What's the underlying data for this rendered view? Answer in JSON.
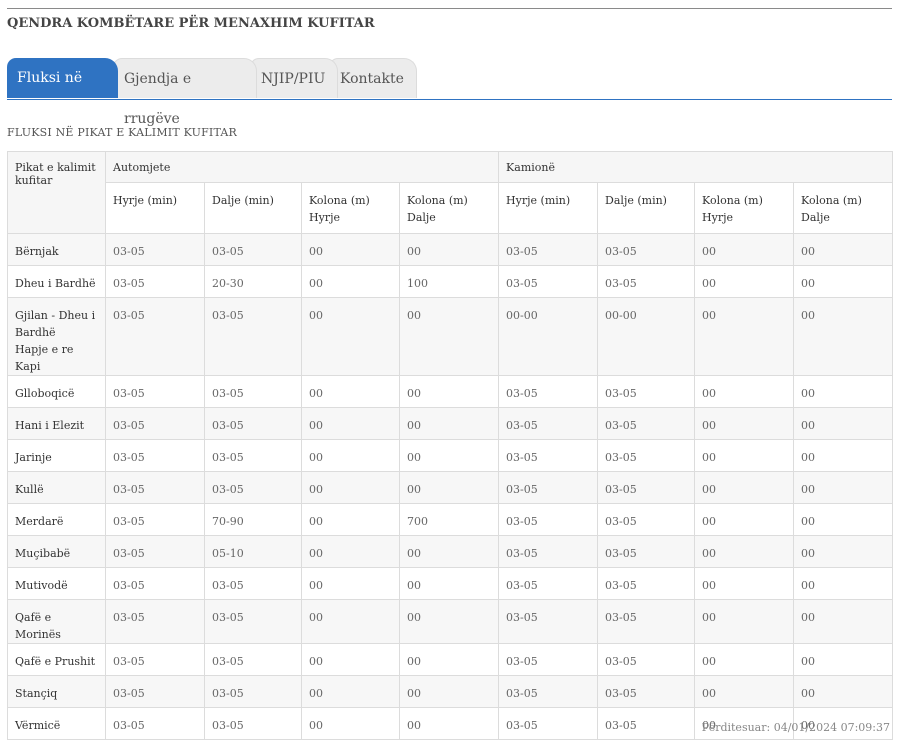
{
  "header": {
    "title": "QENDRA KOMBËTARE PËR MENAXHIM KUFITAR"
  },
  "tabs": [
    {
      "label": "Fluksi në kufi"
    },
    {
      "label": "Gjendja e rrugëve"
    },
    {
      "label": "NJIP/PIU"
    },
    {
      "label": "Kontakte"
    }
  ],
  "section_title": "FLUKSI NË PIKAT E KALIMIT KUFITAR",
  "table": {
    "corner_label": "Pikat e kalimit kufitar",
    "group_cars": "Automjete",
    "group_trucks": "Kamionë",
    "cols": [
      "Hyrje (min)",
      "Dalje (min)",
      "Kolona (m) Hyrje",
      "Kolona (m) Dalje"
    ],
    "rows": [
      {
        "name": "Bërnjak",
        "v": [
          "03-05",
          "03-05",
          "00",
          "00",
          "03-05",
          "03-05",
          "00",
          "00"
        ]
      },
      {
        "name": "Dheu i Bardhë",
        "v": [
          "03-05",
          "20-30",
          "00",
          "100",
          "03-05",
          "03-05",
          "00",
          "00"
        ]
      },
      {
        "name": "Gjilan - Dheu i Bardhë",
        "name2": "Hapje e re Kapi",
        "v": [
          "03-05",
          "03-05",
          "00",
          "00",
          "00-00",
          "00-00",
          "00",
          "00"
        ]
      },
      {
        "name": "Glloboqicë",
        "v": [
          "03-05",
          "03-05",
          "00",
          "00",
          "03-05",
          "03-05",
          "00",
          "00"
        ]
      },
      {
        "name": "Hani i Elezit",
        "v": [
          "03-05",
          "03-05",
          "00",
          "00",
          "03-05",
          "03-05",
          "00",
          "00"
        ]
      },
      {
        "name": "Jarinje",
        "v": [
          "03-05",
          "03-05",
          "00",
          "00",
          "03-05",
          "03-05",
          "00",
          "00"
        ]
      },
      {
        "name": "Kullë",
        "v": [
          "03-05",
          "03-05",
          "00",
          "00",
          "03-05",
          "03-05",
          "00",
          "00"
        ]
      },
      {
        "name": "Merdarë",
        "v": [
          "03-05",
          "70-90",
          "00",
          "700",
          "03-05",
          "03-05",
          "00",
          "00"
        ]
      },
      {
        "name": "Muçibabë",
        "v": [
          "03-05",
          "05-10",
          "00",
          "00",
          "03-05",
          "03-05",
          "00",
          "00"
        ]
      },
      {
        "name": "Mutivodë",
        "v": [
          "03-05",
          "03-05",
          "00",
          "00",
          "03-05",
          "03-05",
          "00",
          "00"
        ]
      },
      {
        "name": "Qafë e Morinës",
        "v": [
          "03-05",
          "03-05",
          "00",
          "00",
          "03-05",
          "03-05",
          "00",
          "00"
        ]
      },
      {
        "name": "Qafë e Prushit",
        "v": [
          "03-05",
          "03-05",
          "00",
          "00",
          "03-05",
          "03-05",
          "00",
          "00"
        ]
      },
      {
        "name": "Stançiq",
        "v": [
          "03-05",
          "03-05",
          "00",
          "00",
          "03-05",
          "03-05",
          "00",
          "00"
        ]
      },
      {
        "name": "Vërmicë",
        "v": [
          "03-05",
          "03-05",
          "00",
          "00",
          "03-05",
          "03-05",
          "00",
          "00"
        ]
      }
    ]
  },
  "footer": {
    "updated": "Përditesuar: 04/01/2024 07:09:37"
  },
  "colors": {
    "accent": "#2f73c2",
    "tab_inactive": "#ececec",
    "row_stripe": "#f7f7f7"
  }
}
